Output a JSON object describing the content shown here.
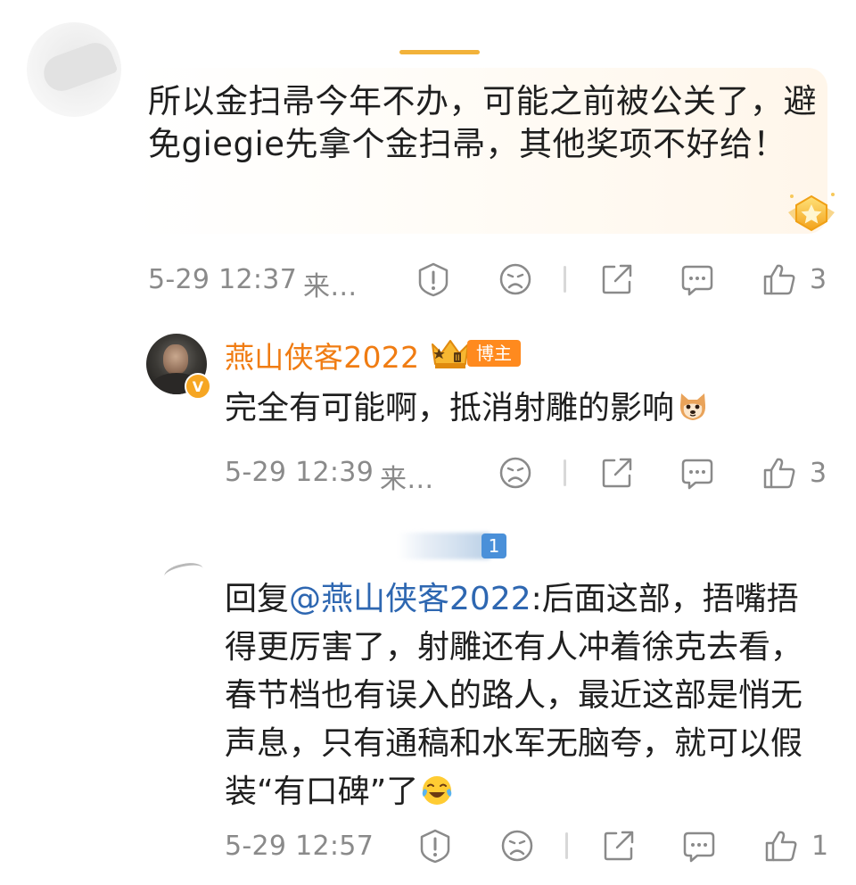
{
  "comments": [
    {
      "text": "所以金扫帚今年不办，可能之前被公关了，避免giegie先拿个金扫帚，其他奖项不好给！",
      "time": "5-29 12:37",
      "source": "来…",
      "likes": "3"
    }
  ],
  "replies": [
    {
      "author": "燕山侠客2022",
      "author_badge": "博主",
      "verified_badge": "V",
      "text": "完全有可能啊，抵消射雕的影响",
      "time": "5-29 12:39",
      "source": "来…",
      "likes": "3"
    },
    {
      "prefix": "回复",
      "mention": "@燕山侠客2022",
      "text": ":后面这部，捂嘴捂得更厉害了，射雕还有人冲着徐克去看，春节档也有误入的路人，最近这部是悄无声息，只有通稿和水军无脑夸，就可以假装“有口碑”了",
      "level_badge": "1",
      "time": "5-29 12:57",
      "likes": "1"
    }
  ],
  "colors": {
    "author_name": "#f07c12",
    "mention": "#2e67b1",
    "meta_gray": "#8a8a8a"
  },
  "icons": [
    "report-icon",
    "sad-face-icon",
    "share-icon",
    "comment-icon",
    "like-icon",
    "gold-star-badge-icon",
    "crown-icon",
    "dog-emoji",
    "laugh-cry-emoji"
  ]
}
